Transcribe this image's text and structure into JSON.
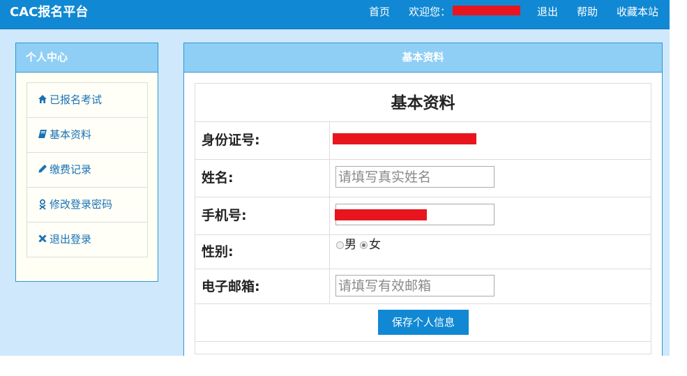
{
  "header": {
    "brand": "CAC报名平台",
    "nav": {
      "home": "首页",
      "welcome": "欢迎您：",
      "logout": "退出",
      "help": "帮助",
      "favorite": "收藏本站"
    }
  },
  "sidebar": {
    "title": "个人中心",
    "items": [
      {
        "icon": "home-icon",
        "label": "已报名考试"
      },
      {
        "icon": "book-icon",
        "label": "基本资料"
      },
      {
        "icon": "pencil-icon",
        "label": "缴费记录"
      },
      {
        "icon": "user-key-icon",
        "label": "修改登录密码"
      },
      {
        "icon": "close-icon",
        "label": "退出登录"
      }
    ]
  },
  "main": {
    "panel_title": "基本资料",
    "form_title": "基本资料",
    "fields": {
      "id_number": {
        "label": "身份证号:"
      },
      "name": {
        "label": "姓名:",
        "placeholder": "请填写真实姓名"
      },
      "phone": {
        "label": "手机号:"
      },
      "gender": {
        "label": "性别:",
        "options": [
          "男",
          "女"
        ],
        "selected": "女"
      },
      "email": {
        "label": "电子邮箱:",
        "placeholder": "请填写有效邮箱"
      }
    },
    "save_label": "保存个人信息"
  },
  "colors": {
    "topbar": "#1188d3",
    "panel_header": "#8fcff5",
    "page_background": "#cfe8fb",
    "redaction": "#e8151f",
    "link": "#1a72b5"
  }
}
